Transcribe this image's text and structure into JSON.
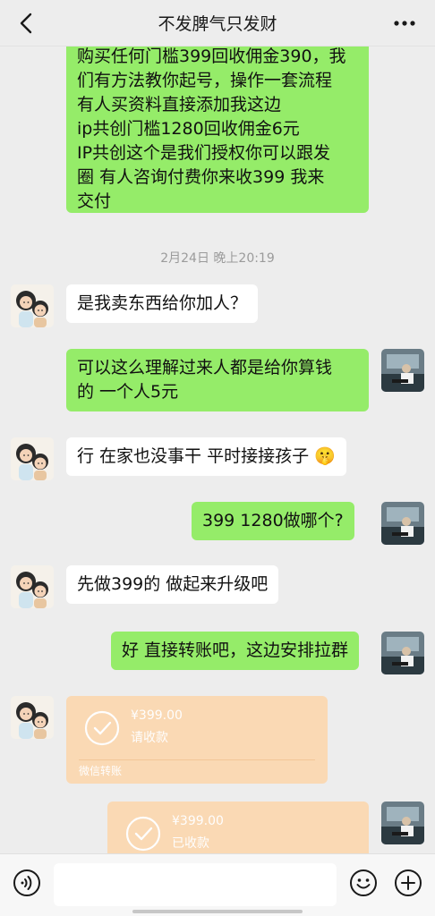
{
  "header": {
    "title": "不发脾气只发财"
  },
  "messages": {
    "first": {
      "lines": [
        "购买任何门槛399回收佣金390，我",
        "们有方法教你起号，操作一套流程",
        "有人买资料直接添加我这边",
        "ip共创门槛1280回收佣金6元",
        "IP共创这个是我们授权你可以跟发",
        "圈  有人咨询付费你来收399  我来",
        "交付"
      ]
    },
    "timestamp": "2月24日 晚上20:19",
    "m1": "是我卖东西给你加人？",
    "m2": [
      "可以这么理解过来人都是给你算钱",
      "的 一个人5元"
    ],
    "m3": "行 在家也没事干 平时接接孩子",
    "m3_emoji": "🤫",
    "m4": "399   1280做哪个?",
    "m5": "先做399的 做起来升级吧",
    "m6": "好 直接转账吧，这边安排拉群",
    "transfer1": {
      "amount": "¥399.00",
      "status": "请收款",
      "footer": "微信转账"
    },
    "transfer2": {
      "amount": "¥399.00",
      "status": "已收款"
    }
  },
  "input": {
    "placeholder": ""
  },
  "colors": {
    "me_bubble": "#95ec69",
    "other_bubble": "#ffffff",
    "transfer": "#fbd8b1",
    "background": "#ededed"
  },
  "icons": {
    "back": "chevron-left-icon",
    "more": "more-dots-icon",
    "voice": "voice-icon",
    "emoji": "emoji-icon",
    "plus": "plus-icon"
  }
}
